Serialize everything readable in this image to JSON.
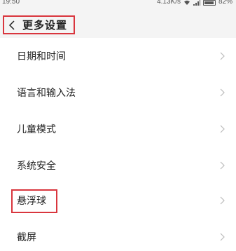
{
  "status_bar": {
    "time": "19:50",
    "network_speed": "4.13K/s",
    "battery": "82%"
  },
  "header": {
    "title": "更多设置",
    "back_icon": "chevron-left-icon"
  },
  "groups": [
    {
      "items": [
        {
          "label": "日期和时间"
        },
        {
          "label": "语言和输入法"
        }
      ]
    },
    {
      "items": [
        {
          "label": "儿童模式"
        },
        {
          "label": "系统安全"
        }
      ]
    },
    {
      "items": [
        {
          "label": "悬浮球",
          "highlighted": true
        },
        {
          "label": "截屏"
        }
      ]
    }
  ],
  "colors": {
    "highlight_border": "#d9363e",
    "background": "#f4f4f4",
    "card": "#ffffff"
  }
}
